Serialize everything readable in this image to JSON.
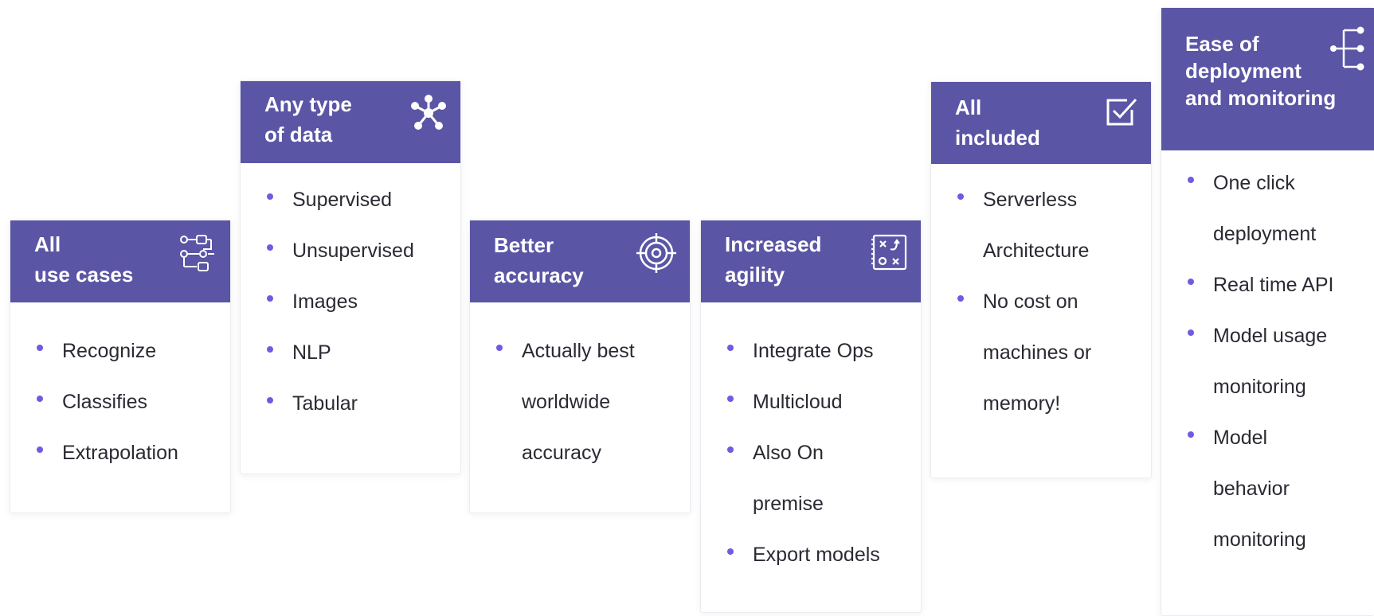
{
  "colors": {
    "header_bg": "#5b55a5",
    "bullet": "#6c5ce0",
    "text": "#2a2a33"
  },
  "cards": [
    {
      "title": "All\nuse cases",
      "icon": "workflow-icon",
      "items": [
        "Recognize",
        "Classifies",
        "Extrapolation"
      ]
    },
    {
      "title": "Any type\nof data",
      "icon": "network-nodes-icon",
      "items": [
        "Supervised",
        "Unsupervised",
        "Images",
        "NLP",
        "Tabular"
      ]
    },
    {
      "title": "Better\naccuracy",
      "icon": "target-icon",
      "items": [
        "Actually best worldwide accuracy"
      ]
    },
    {
      "title": "Increased\nagility",
      "icon": "strategy-board-icon",
      "items": [
        "Integrate Ops",
        "Multicloud",
        "Also On premise",
        "Export models"
      ]
    },
    {
      "title": "All\nincluded",
      "icon": "checkbox-icon",
      "items": [
        "Serverless Architecture",
        "No cost on machines or memory!"
      ]
    },
    {
      "title": "Ease of\ndeployment\nand monitoring",
      "icon": "deployment-tree-icon",
      "items": [
        "One click deployment",
        "Real time API",
        "Model usage monitoring",
        "Model behavior monitoring"
      ]
    }
  ]
}
